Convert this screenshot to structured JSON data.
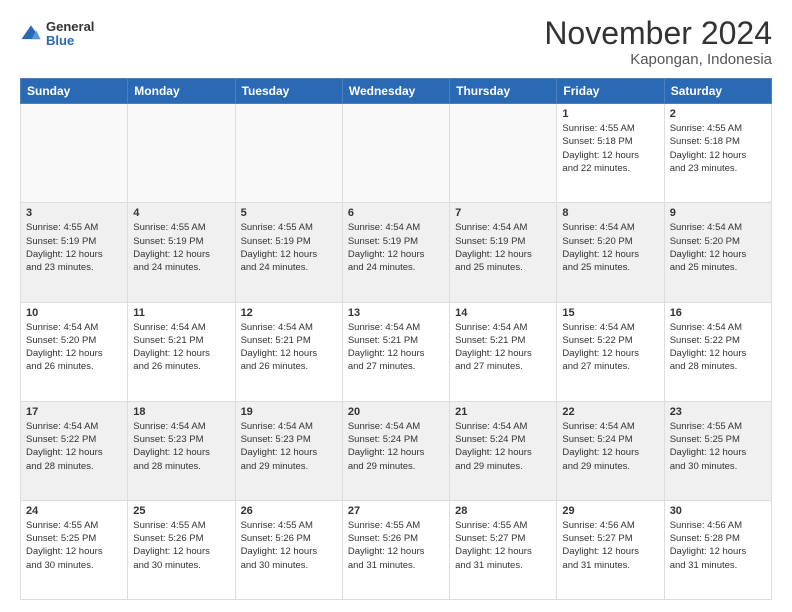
{
  "logo": {
    "general": "General",
    "blue": "Blue"
  },
  "title": "November 2024",
  "subtitle": "Kapongan, Indonesia",
  "weekdays": [
    "Sunday",
    "Monday",
    "Tuesday",
    "Wednesday",
    "Thursday",
    "Friday",
    "Saturday"
  ],
  "weeks": [
    [
      {
        "day": "",
        "info": ""
      },
      {
        "day": "",
        "info": ""
      },
      {
        "day": "",
        "info": ""
      },
      {
        "day": "",
        "info": ""
      },
      {
        "day": "",
        "info": ""
      },
      {
        "day": "1",
        "info": "Sunrise: 4:55 AM\nSunset: 5:18 PM\nDaylight: 12 hours\nand 22 minutes."
      },
      {
        "day": "2",
        "info": "Sunrise: 4:55 AM\nSunset: 5:18 PM\nDaylight: 12 hours\nand 23 minutes."
      }
    ],
    [
      {
        "day": "3",
        "info": "Sunrise: 4:55 AM\nSunset: 5:19 PM\nDaylight: 12 hours\nand 23 minutes."
      },
      {
        "day": "4",
        "info": "Sunrise: 4:55 AM\nSunset: 5:19 PM\nDaylight: 12 hours\nand 24 minutes."
      },
      {
        "day": "5",
        "info": "Sunrise: 4:55 AM\nSunset: 5:19 PM\nDaylight: 12 hours\nand 24 minutes."
      },
      {
        "day": "6",
        "info": "Sunrise: 4:54 AM\nSunset: 5:19 PM\nDaylight: 12 hours\nand 24 minutes."
      },
      {
        "day": "7",
        "info": "Sunrise: 4:54 AM\nSunset: 5:19 PM\nDaylight: 12 hours\nand 25 minutes."
      },
      {
        "day": "8",
        "info": "Sunrise: 4:54 AM\nSunset: 5:20 PM\nDaylight: 12 hours\nand 25 minutes."
      },
      {
        "day": "9",
        "info": "Sunrise: 4:54 AM\nSunset: 5:20 PM\nDaylight: 12 hours\nand 25 minutes."
      }
    ],
    [
      {
        "day": "10",
        "info": "Sunrise: 4:54 AM\nSunset: 5:20 PM\nDaylight: 12 hours\nand 26 minutes."
      },
      {
        "day": "11",
        "info": "Sunrise: 4:54 AM\nSunset: 5:21 PM\nDaylight: 12 hours\nand 26 minutes."
      },
      {
        "day": "12",
        "info": "Sunrise: 4:54 AM\nSunset: 5:21 PM\nDaylight: 12 hours\nand 26 minutes."
      },
      {
        "day": "13",
        "info": "Sunrise: 4:54 AM\nSunset: 5:21 PM\nDaylight: 12 hours\nand 27 minutes."
      },
      {
        "day": "14",
        "info": "Sunrise: 4:54 AM\nSunset: 5:21 PM\nDaylight: 12 hours\nand 27 minutes."
      },
      {
        "day": "15",
        "info": "Sunrise: 4:54 AM\nSunset: 5:22 PM\nDaylight: 12 hours\nand 27 minutes."
      },
      {
        "day": "16",
        "info": "Sunrise: 4:54 AM\nSunset: 5:22 PM\nDaylight: 12 hours\nand 28 minutes."
      }
    ],
    [
      {
        "day": "17",
        "info": "Sunrise: 4:54 AM\nSunset: 5:22 PM\nDaylight: 12 hours\nand 28 minutes."
      },
      {
        "day": "18",
        "info": "Sunrise: 4:54 AM\nSunset: 5:23 PM\nDaylight: 12 hours\nand 28 minutes."
      },
      {
        "day": "19",
        "info": "Sunrise: 4:54 AM\nSunset: 5:23 PM\nDaylight: 12 hours\nand 29 minutes."
      },
      {
        "day": "20",
        "info": "Sunrise: 4:54 AM\nSunset: 5:24 PM\nDaylight: 12 hours\nand 29 minutes."
      },
      {
        "day": "21",
        "info": "Sunrise: 4:54 AM\nSunset: 5:24 PM\nDaylight: 12 hours\nand 29 minutes."
      },
      {
        "day": "22",
        "info": "Sunrise: 4:54 AM\nSunset: 5:24 PM\nDaylight: 12 hours\nand 29 minutes."
      },
      {
        "day": "23",
        "info": "Sunrise: 4:55 AM\nSunset: 5:25 PM\nDaylight: 12 hours\nand 30 minutes."
      }
    ],
    [
      {
        "day": "24",
        "info": "Sunrise: 4:55 AM\nSunset: 5:25 PM\nDaylight: 12 hours\nand 30 minutes."
      },
      {
        "day": "25",
        "info": "Sunrise: 4:55 AM\nSunset: 5:26 PM\nDaylight: 12 hours\nand 30 minutes."
      },
      {
        "day": "26",
        "info": "Sunrise: 4:55 AM\nSunset: 5:26 PM\nDaylight: 12 hours\nand 30 minutes."
      },
      {
        "day": "27",
        "info": "Sunrise: 4:55 AM\nSunset: 5:26 PM\nDaylight: 12 hours\nand 31 minutes."
      },
      {
        "day": "28",
        "info": "Sunrise: 4:55 AM\nSunset: 5:27 PM\nDaylight: 12 hours\nand 31 minutes."
      },
      {
        "day": "29",
        "info": "Sunrise: 4:56 AM\nSunset: 5:27 PM\nDaylight: 12 hours\nand 31 minutes."
      },
      {
        "day": "30",
        "info": "Sunrise: 4:56 AM\nSunset: 5:28 PM\nDaylight: 12 hours\nand 31 minutes."
      }
    ]
  ]
}
